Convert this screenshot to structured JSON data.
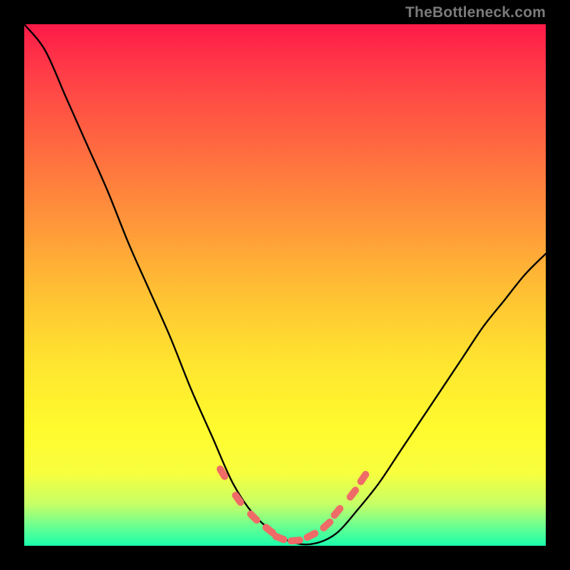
{
  "watermark": {
    "text": "TheBottleneck.com"
  },
  "chart_data": {
    "type": "line",
    "title": "",
    "xlabel": "",
    "ylabel": "",
    "xlim": [
      0,
      1
    ],
    "ylim": [
      0,
      1
    ],
    "background_gradient": {
      "top_color": "#ff1a49",
      "bottom_color": "#1affab",
      "note": "vertical gradient red→orange→yellow→green"
    },
    "series": [
      {
        "name": "bottleneck-curve",
        "color": "#000000",
        "stroke_width": 2,
        "x": [
          0.0,
          0.04,
          0.08,
          0.12,
          0.16,
          0.2,
          0.24,
          0.28,
          0.32,
          0.36,
          0.4,
          0.44,
          0.48,
          0.52,
          0.56,
          0.6,
          0.64,
          0.68,
          0.72,
          0.76,
          0.8,
          0.84,
          0.88,
          0.92,
          0.96,
          1.0
        ],
        "y": [
          1.0,
          0.95,
          0.86,
          0.77,
          0.68,
          0.58,
          0.49,
          0.4,
          0.3,
          0.21,
          0.12,
          0.06,
          0.025,
          0.005,
          0.005,
          0.025,
          0.07,
          0.12,
          0.18,
          0.24,
          0.3,
          0.36,
          0.42,
          0.47,
          0.52,
          0.56
        ],
        "note": "y is height above bottom as fraction of plot height (0 at bottom, 1 at top)"
      },
      {
        "name": "bottleneck-markers",
        "color": "#ef6b67",
        "marker_shape": "rounded-dash",
        "x": [
          0.38,
          0.41,
          0.44,
          0.47,
          0.49,
          0.52,
          0.55,
          0.58,
          0.6,
          0.63,
          0.65
        ],
        "y": [
          0.14,
          0.09,
          0.055,
          0.03,
          0.015,
          0.01,
          0.02,
          0.04,
          0.065,
          0.1,
          0.13
        ],
        "note": "salmon dash markers clustered near the valley"
      }
    ]
  }
}
